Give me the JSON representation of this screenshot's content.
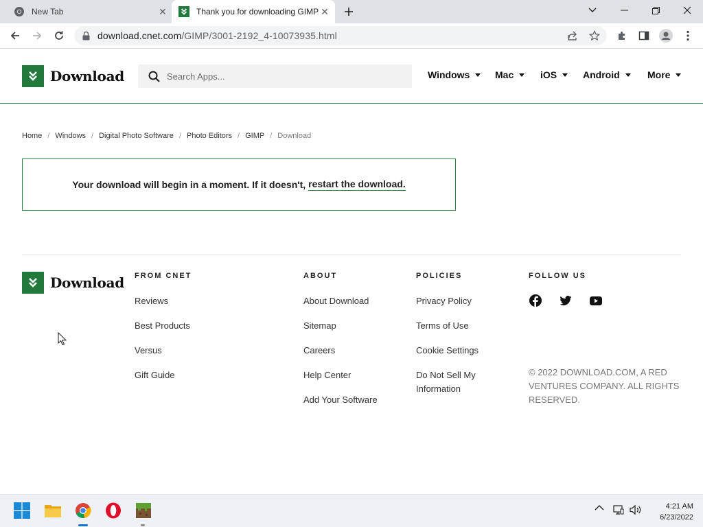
{
  "browser": {
    "tabs": [
      {
        "title": "New Tab",
        "favicon": "chrome-icon",
        "active": false
      },
      {
        "title": "Thank you for downloading GIMP",
        "favicon": "download-favicon",
        "active": true
      }
    ],
    "url": {
      "domain": "download.cnet.com",
      "path": "/GIMP/3001-2192_4-10073935.html"
    }
  },
  "header": {
    "logo_text": "Download",
    "search_placeholder": "Search Apps...",
    "nav": [
      "Windows",
      "Mac",
      "iOS",
      "Android",
      "More"
    ]
  },
  "breadcrumb": [
    "Home",
    "Windows",
    "Digital Photo Software",
    "Photo Editors",
    "GIMP",
    "Download"
  ],
  "notice": {
    "text": "Your download will begin in a moment. If it doesn't,",
    "link": "restart the download."
  },
  "footer": {
    "logo_text": "Download",
    "from_cnet": {
      "heading": "FROM CNET",
      "links": [
        "Reviews",
        "Best Products",
        "Versus",
        "Gift Guide"
      ]
    },
    "about": {
      "heading": "ABOUT",
      "links": [
        "About Download",
        "Sitemap",
        "Careers",
        "Help Center",
        "Add Your Software"
      ]
    },
    "policies": {
      "heading": "POLICIES",
      "links": [
        "Privacy Policy",
        "Terms of Use",
        "Cookie Settings",
        "Do Not Sell My Information"
      ]
    },
    "follow": {
      "heading": "FOLLOW US",
      "icons": [
        "facebook-icon",
        "twitter-icon",
        "youtube-icon"
      ]
    },
    "copyright": "© 2022 DOWNLOAD.COM, A RED VENTURES COMPANY. ALL RIGHTS RESERVED."
  },
  "taskbar": {
    "apps": [
      "windows-start-icon",
      "file-explorer-icon",
      "chrome-icon",
      "opera-icon",
      "minecraft-icon"
    ],
    "time": "4:21 AM",
    "date": "6/23/2022"
  },
  "colors": {
    "brand": "#217a3c",
    "accent_border": "#2b7a3f",
    "tab_bar": "#dee1e6",
    "omnibox": "#f1f3f4"
  }
}
